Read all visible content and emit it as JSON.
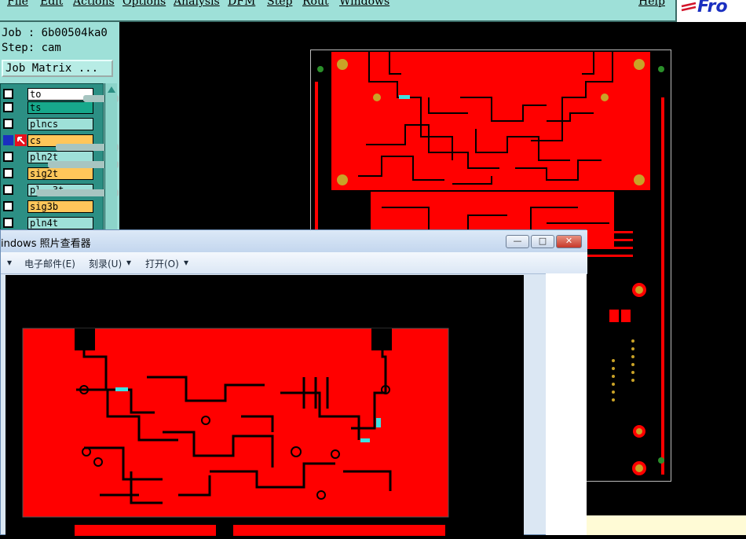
{
  "menu": {
    "items": [
      "File",
      "Edit",
      "Actions",
      "Options",
      "Analysis",
      "DFM",
      "Step",
      "Rout",
      "Windows"
    ],
    "help": "Help",
    "logo_text": "Fro"
  },
  "job": {
    "job_label": "Job : 6b00504ka0",
    "step_label": "Step: cam",
    "matrix_button": "Job Matrix ..."
  },
  "layers": [
    {
      "name": "to",
      "color": "#ffffff"
    },
    {
      "name": "ts",
      "color": "#17a88b"
    },
    {
      "name": "plncs",
      "color": "#9ee0d8"
    },
    {
      "name": "cs",
      "color": "#ffc65a",
      "active": true
    },
    {
      "name": "pln2t",
      "color": "#9ee0d8"
    },
    {
      "name": "sig2t",
      "color": "#ffc65a"
    },
    {
      "name": "pl..3t",
      "color": "#9ee0d8"
    },
    {
      "name": "sig3b",
      "color": "#ffc65a"
    },
    {
      "name": "pln4t",
      "color": "#9ee0d8"
    }
  ],
  "viewer": {
    "title": "indows 照片查看器",
    "toolbar": {
      "email": "电子邮件(E)",
      "burn": "刻录(U)",
      "open": "打开(O)"
    },
    "help_icon": "?"
  },
  "colors": {
    "copper": "#ff0000",
    "background": "#000000",
    "panel": "#9ee0d8"
  }
}
